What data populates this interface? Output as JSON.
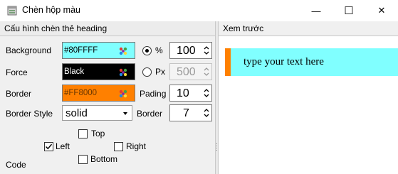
{
  "window": {
    "title": "Chèn hộp màu",
    "minimize_glyph": "—",
    "maximize_glyph": "☐",
    "close_glyph": "✕"
  },
  "config": {
    "header": "Cấu hình chèn thẻ heading",
    "background": {
      "label": "Background",
      "value": "#80FFFF",
      "color": "#80FFFF"
    },
    "force": {
      "label": "Force",
      "value": "Black",
      "color": "#000000",
      "text_color": "#ffffff"
    },
    "border": {
      "label": "Border",
      "value": "#FF8000",
      "color": "#FF8000"
    },
    "border_style": {
      "label": "Border Style",
      "value": "solid"
    },
    "unit_percent": {
      "label": "%",
      "value": "100",
      "selected": true
    },
    "unit_px": {
      "label": "Px",
      "value": "500",
      "selected": false
    },
    "pading": {
      "label": "Pading",
      "value": "10"
    },
    "border_width": {
      "label": "Border",
      "value": "7"
    },
    "code": {
      "label": "Code"
    },
    "positions": {
      "top": {
        "label": "Top",
        "checked": false
      },
      "left": {
        "label": "Left",
        "checked": true
      },
      "right": {
        "label": "Right",
        "checked": false
      },
      "bottom": {
        "label": "Bottom",
        "checked": false
      }
    }
  },
  "preview": {
    "header": "Xem trước",
    "text": "type your text here",
    "background": "#80FFFF",
    "border_color": "#FF8000"
  },
  "icons": {
    "app": "document-table-icon",
    "palette": "color-palette-icon"
  }
}
